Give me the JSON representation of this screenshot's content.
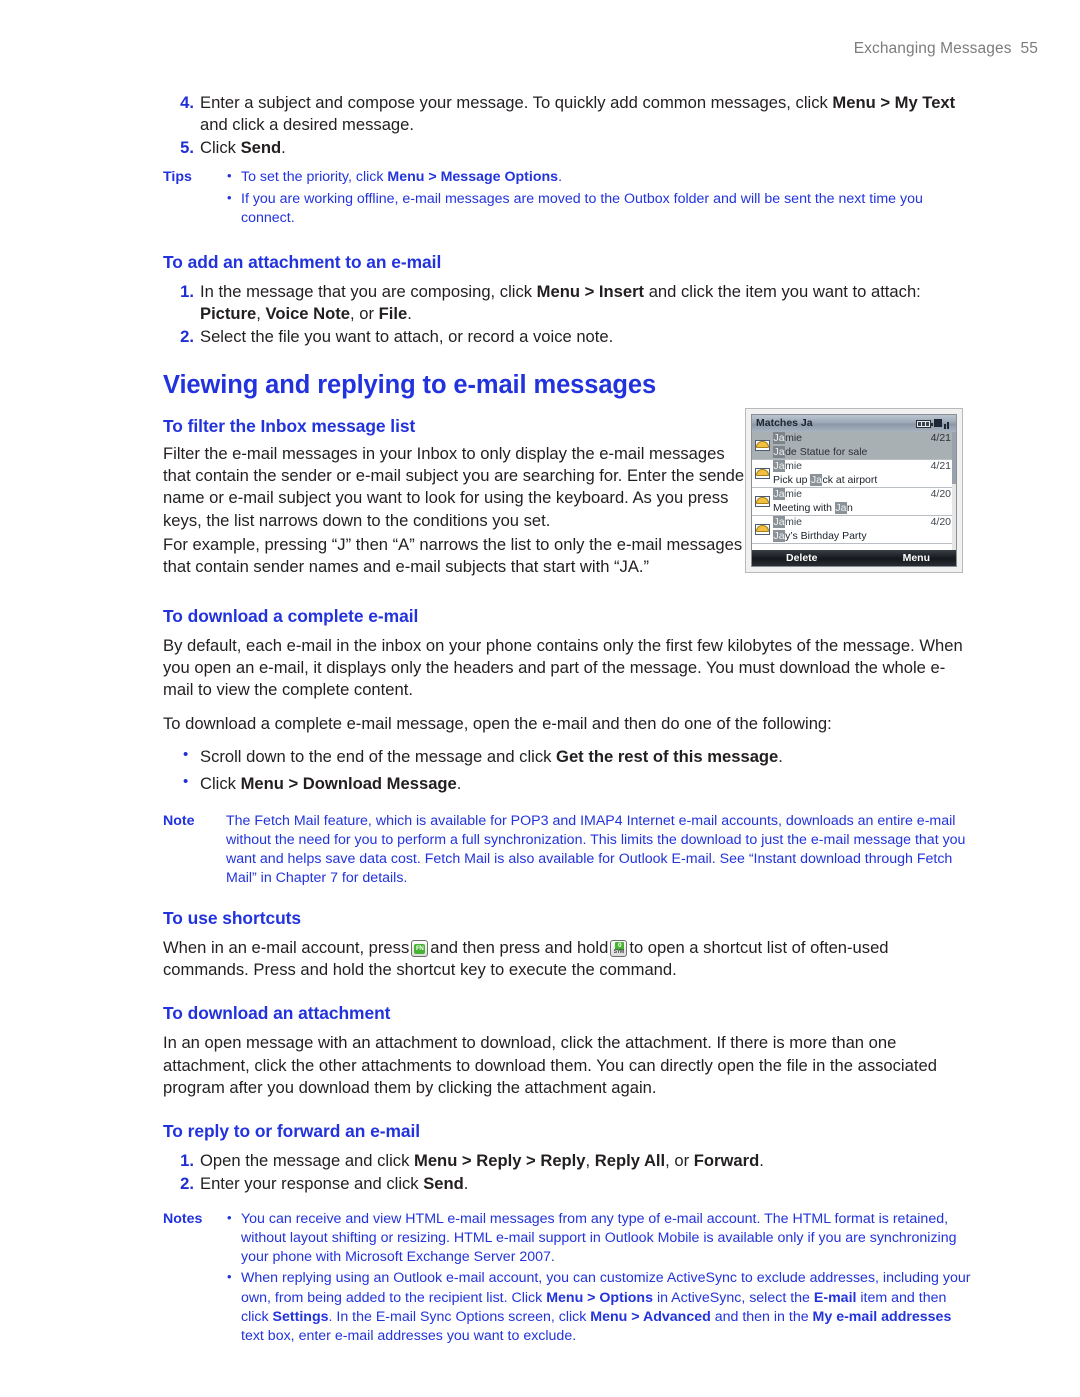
{
  "colors": {
    "heading_blue": "#2233dd",
    "note_blue": "#2233dd",
    "body_black": "#231f20",
    "header_gray": "#7c7c7c",
    "key_green": "#46b432"
  },
  "running_header": {
    "title": "Exchanging Messages",
    "page_number": "55"
  },
  "steps_top": [
    {
      "num": "4.",
      "parts": [
        {
          "t": "Enter a subject and compose your message. To quickly add common messages, click ",
          "b": false
        },
        {
          "t": "Menu > My Text",
          "b": true
        },
        {
          "t": " and click a desired message.",
          "b": false
        }
      ]
    },
    {
      "num": "5.",
      "parts": [
        {
          "t": "Click ",
          "b": false
        },
        {
          "t": "Send",
          "b": true
        },
        {
          "t": ".",
          "b": false
        }
      ]
    }
  ],
  "tips_block": {
    "label": "Tips",
    "items": [
      [
        {
          "t": "To set the priority, click ",
          "b": false
        },
        {
          "t": "Menu > Message Options",
          "b": true
        },
        {
          "t": ".",
          "b": false
        }
      ],
      [
        {
          "t": "If you are working offline, e-mail messages are moved to the Outbox folder and will be sent the next time you connect.",
          "b": false
        }
      ]
    ]
  },
  "attachment_section": {
    "heading": "To add an attachment to an e-mail",
    "steps": [
      {
        "num": "1.",
        "parts": [
          {
            "t": "In the message that you are composing, click ",
            "b": false
          },
          {
            "t": "Menu > Insert",
            "b": true
          },
          {
            "t": " and click the item you want to attach: ",
            "b": false
          },
          {
            "t": "Picture",
            "b": true
          },
          {
            "t": ", ",
            "b": false
          },
          {
            "t": "Voice Note",
            "b": true
          },
          {
            "t": ", or ",
            "b": false
          },
          {
            "t": "File",
            "b": true
          },
          {
            "t": ".",
            "b": false
          }
        ]
      },
      {
        "num": "2.",
        "parts": [
          {
            "t": "Select the file you want to attach, or record a voice note.",
            "b": false
          }
        ]
      }
    ]
  },
  "main_section": {
    "heading": "Viewing and replying to e-mail messages"
  },
  "filter_section": {
    "heading": "To filter the Inbox message list",
    "paragraph1": "Filter the e-mail messages in your Inbox to only display the e-mail messages that contain the sender or e-mail subject you are searching for. Enter the sender name or e-mail subject you want to look for using the keyboard. As you press keys, the list narrows down to the conditions you set.",
    "paragraph2": "For example, pressing “J” then “A” narrows the list to only the e-mail messages that contain sender names and e-mail subjects that start with “JA.”"
  },
  "phone_figure": {
    "title": "Matches Ja",
    "status_icons": [
      "battery-icon",
      "signal-icon"
    ],
    "rows": [
      {
        "sender_match": "Ja",
        "sender_rest": "mie",
        "date": "4/21",
        "subject_match": "Ja",
        "subject_rest": "de Statue for sale",
        "subject_prefix": "",
        "selected": true
      },
      {
        "sender_match": "Ja",
        "sender_rest": "mie",
        "date": "4/21",
        "subject_prefix": "Pick up ",
        "subject_match": "Ja",
        "subject_rest": "ck at airport",
        "selected": false
      },
      {
        "sender_match": "Ja",
        "sender_rest": "mie",
        "date": "4/20",
        "subject_prefix": "Meeting with ",
        "subject_match": "Ja",
        "subject_rest": "n",
        "selected": false
      },
      {
        "sender_match": "Ja",
        "sender_rest": "mie",
        "date": "4/20",
        "subject_prefix": "",
        "subject_match": "Ja",
        "subject_rest": "y’s Birthday Party",
        "selected": false
      }
    ],
    "softkey_left": "Delete",
    "softkey_right": "Menu"
  },
  "download_section": {
    "heading": "To download a complete e-mail",
    "paragraph1": "By default, each e-mail in the inbox on your phone contains only the first few kilobytes of the message. When you open an e-mail, it displays only the headers and part of the message. You must download the whole e-mail to view the complete content.",
    "paragraph2": "To download a complete e-mail message, open the e-mail and then do one of the following:",
    "bullets": [
      [
        {
          "t": "Scroll down to the end of the message and click ",
          "b": false
        },
        {
          "t": "Get the rest of this message",
          "b": true
        },
        {
          "t": ".",
          "b": false
        }
      ],
      [
        {
          "t": "Click ",
          "b": false
        },
        {
          "t": "Menu > Download Message",
          "b": true
        },
        {
          "t": ".",
          "b": false
        }
      ]
    ]
  },
  "note_block": {
    "label": "Note",
    "text": "The Fetch Mail feature, which is available for POP3 and IMAP4 Internet e-mail accounts, downloads an entire e-mail without the need for you to perform a full synchronization. This limits the download to just the e-mail message that you want and helps save data cost. Fetch Mail is also available for Outlook E-mail. See “Instant download through Fetch Mail” in Chapter 7 for details."
  },
  "shortcuts_section": {
    "heading": "To use shortcuts",
    "text_part1": "When in an e-mail account, press",
    "key1_label": "FN",
    "text_part2": "and then press and hold",
    "key2_top_label": "0",
    "key2_bottom_label": "SYM",
    "text_part3": "to open a shortcut list of often-used commands. Press and hold the shortcut key to execute the command."
  },
  "attachment_download_section": {
    "heading": "To download an attachment",
    "paragraph": "In an open message with an attachment to download, click the attachment. If there is more than one attachment, click the other attachments to download them. You can directly open the file in the associated program after you download them by clicking the attachment again."
  },
  "reply_section": {
    "heading": "To reply to or forward an e-mail",
    "steps": [
      {
        "num": "1.",
        "parts": [
          {
            "t": "Open the message and click ",
            "b": false
          },
          {
            "t": "Menu > Reply > Reply",
            "b": true
          },
          {
            "t": ", ",
            "b": false
          },
          {
            "t": "Reply All",
            "b": true
          },
          {
            "t": ", or ",
            "b": false
          },
          {
            "t": "Forward",
            "b": true
          },
          {
            "t": ".",
            "b": false
          }
        ]
      },
      {
        "num": "2.",
        "parts": [
          {
            "t": "Enter your response and click ",
            "b": false
          },
          {
            "t": "Send",
            "b": true
          },
          {
            "t": ".",
            "b": false
          }
        ]
      }
    ]
  },
  "notes_block": {
    "label": "Notes",
    "items": [
      [
        {
          "t": "You can receive and view HTML e-mail messages from any type of e-mail account. The HTML format is retained, without layout shifting or resizing. HTML e-mail support in Outlook Mobile is available only if you are synchronizing your phone with Microsoft Exchange Server 2007.",
          "b": false
        }
      ],
      [
        {
          "t": "When replying using an Outlook e-mail account, you can customize ActiveSync to exclude addresses, including your own, from being added to the recipient list. Click ",
          "b": false
        },
        {
          "t": "Menu > Options",
          "b": true
        },
        {
          "t": " in ActiveSync, select the ",
          "b": false
        },
        {
          "t": "E-mail",
          "b": true
        },
        {
          "t": " item and then click ",
          "b": false
        },
        {
          "t": "Settings",
          "b": true
        },
        {
          "t": ".  In the E-mail Sync Options screen, click ",
          "b": false
        },
        {
          "t": "Menu > Advanced",
          "b": true
        },
        {
          "t": " and then in the ",
          "b": false
        },
        {
          "t": "My e-mail addresses",
          "b": true
        },
        {
          "t": " text box, enter e-mail addresses you want to exclude.",
          "b": false
        }
      ]
    ]
  }
}
